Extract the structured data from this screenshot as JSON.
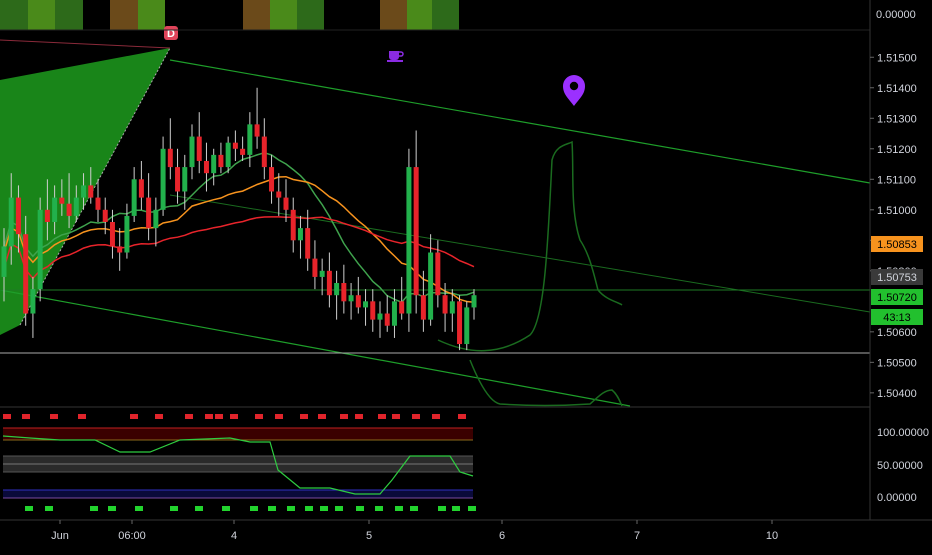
{
  "colors": {
    "background": "#000000",
    "axis_text": "#d1d4dc",
    "up_candle": "#22b14c",
    "down_candle": "#e8242b",
    "channel_green": "#1e9e2a",
    "ma_green": "#3fa34d",
    "ma_orange": "#f7931e",
    "ma_red": "#e8242b",
    "marker_purple": "#9b30ff"
  },
  "price_axis": {
    "ticks": [
      "1.51500",
      "1.51400",
      "1.51300",
      "1.51200",
      "1.51100",
      "1.51000",
      "1.50900",
      "1.50800",
      "1.50600",
      "1.50500",
      "1.50400"
    ],
    "top_pane_tick": "0.00000"
  },
  "price_badges": [
    {
      "text": "1.50853",
      "bg": "#f7931e",
      "fg": "#000000"
    },
    {
      "text": "1.50753",
      "bg": "#3a3a3a",
      "fg": "#d1d4dc"
    },
    {
      "text": "1.50720",
      "bg": "#22c02e",
      "fg": "#000000"
    },
    {
      "text": "43:13",
      "bg": "#22c02e",
      "fg": "#000000"
    }
  ],
  "oscillator_axis": {
    "ticks": [
      "100.00000",
      "50.00000",
      "0.00000"
    ]
  },
  "time_axis": {
    "labels": [
      "Jun",
      "06:00",
      "4",
      "5",
      "6",
      "7",
      "10"
    ]
  },
  "markers": {
    "d_label": "D",
    "coffee_icon": "coffee-cup-icon",
    "pin_icon": "map-pin-icon"
  },
  "chart_data": {
    "type": "candlestick",
    "y_range": [
      1.5037,
      1.5155
    ],
    "current_price": 1.5072,
    "countdown": "43:13",
    "candles": [
      [
        1.5078,
        1.5094,
        1.507,
        1.5088
      ],
      [
        1.5088,
        1.5112,
        1.5082,
        1.5104
      ],
      [
        1.5104,
        1.5108,
        1.5086,
        1.5092
      ],
      [
        1.5092,
        1.5098,
        1.5062,
        1.5066
      ],
      [
        1.5066,
        1.5078,
        1.5058,
        1.5074
      ],
      [
        1.5074,
        1.5104,
        1.507,
        1.51
      ],
      [
        1.51,
        1.511,
        1.509,
        1.5096
      ],
      [
        1.5096,
        1.5108,
        1.5092,
        1.5104
      ],
      [
        1.5104,
        1.511,
        1.5098,
        1.5102
      ],
      [
        1.5102,
        1.5112,
        1.5094,
        1.5098
      ],
      [
        1.5098,
        1.5108,
        1.5096,
        1.5104
      ],
      [
        1.5104,
        1.5112,
        1.51,
        1.5108
      ],
      [
        1.5108,
        1.5114,
        1.5102,
        1.5104
      ],
      [
        1.5104,
        1.511,
        1.5096,
        1.51
      ],
      [
        1.51,
        1.5104,
        1.5092,
        1.5096
      ],
      [
        1.5096,
        1.51,
        1.5084,
        1.5088
      ],
      [
        1.5088,
        1.5094,
        1.508,
        1.5086
      ],
      [
        1.5086,
        1.5102,
        1.5084,
        1.5098
      ],
      [
        1.5098,
        1.5114,
        1.5096,
        1.511
      ],
      [
        1.511,
        1.5116,
        1.51,
        1.5104
      ],
      [
        1.5104,
        1.5112,
        1.509,
        1.5094
      ],
      [
        1.5094,
        1.5104,
        1.5088,
        1.51
      ],
      [
        1.51,
        1.5124,
        1.5098,
        1.512
      ],
      [
        1.512,
        1.513,
        1.511,
        1.5114
      ],
      [
        1.5114,
        1.512,
        1.5102,
        1.5106
      ],
      [
        1.5106,
        1.5118,
        1.51,
        1.5114
      ],
      [
        1.5114,
        1.5128,
        1.511,
        1.5124
      ],
      [
        1.5124,
        1.5132,
        1.5112,
        1.5116
      ],
      [
        1.5116,
        1.5122,
        1.5106,
        1.5112
      ],
      [
        1.5112,
        1.512,
        1.5108,
        1.5118
      ],
      [
        1.5118,
        1.5122,
        1.5112,
        1.5114
      ],
      [
        1.5114,
        1.5124,
        1.5112,
        1.5122
      ],
      [
        1.5122,
        1.5126,
        1.5116,
        1.512
      ],
      [
        1.512,
        1.5124,
        1.5116,
        1.5118
      ],
      [
        1.5118,
        1.5132,
        1.5114,
        1.5128
      ],
      [
        1.5128,
        1.514,
        1.512,
        1.5124
      ],
      [
        1.5124,
        1.513,
        1.511,
        1.5114
      ],
      [
        1.5114,
        1.5118,
        1.5102,
        1.5106
      ],
      [
        1.5106,
        1.5112,
        1.5098,
        1.5104
      ],
      [
        1.5104,
        1.511,
        1.5096,
        1.51
      ],
      [
        1.51,
        1.5104,
        1.5086,
        1.509
      ],
      [
        1.509,
        1.5098,
        1.5084,
        1.5094
      ],
      [
        1.5094,
        1.51,
        1.508,
        1.5084
      ],
      [
        1.5084,
        1.509,
        1.5074,
        1.5078
      ],
      [
        1.5078,
        1.5084,
        1.5072,
        1.508
      ],
      [
        1.508,
        1.5086,
        1.5068,
        1.5072
      ],
      [
        1.5072,
        1.508,
        1.5064,
        1.5076
      ],
      [
        1.5076,
        1.5082,
        1.5066,
        1.507
      ],
      [
        1.507,
        1.5076,
        1.5064,
        1.5072
      ],
      [
        1.5072,
        1.5078,
        1.5066,
        1.5068
      ],
      [
        1.5068,
        1.5074,
        1.5062,
        1.507
      ],
      [
        1.507,
        1.5074,
        1.506,
        1.5064
      ],
      [
        1.5064,
        1.507,
        1.5058,
        1.5066
      ],
      [
        1.5066,
        1.5072,
        1.506,
        1.5062
      ],
      [
        1.5062,
        1.5074,
        1.5058,
        1.507
      ],
      [
        1.507,
        1.5078,
        1.5064,
        1.5066
      ],
      [
        1.5066,
        1.512,
        1.506,
        1.5114
      ],
      [
        1.5114,
        1.5126,
        1.5066,
        1.5072
      ],
      [
        1.5072,
        1.508,
        1.506,
        1.5064
      ],
      [
        1.5064,
        1.5092,
        1.5062,
        1.5086
      ],
      [
        1.5086,
        1.509,
        1.5068,
        1.5072
      ],
      [
        1.5072,
        1.5076,
        1.506,
        1.5066
      ],
      [
        1.5066,
        1.5074,
        1.506,
        1.507
      ],
      [
        1.507,
        1.5072,
        1.5054,
        1.5056
      ],
      [
        1.5056,
        1.507,
        1.5054,
        1.5068
      ],
      [
        1.5068,
        1.5074,
        1.5064,
        1.5072
      ]
    ]
  }
}
